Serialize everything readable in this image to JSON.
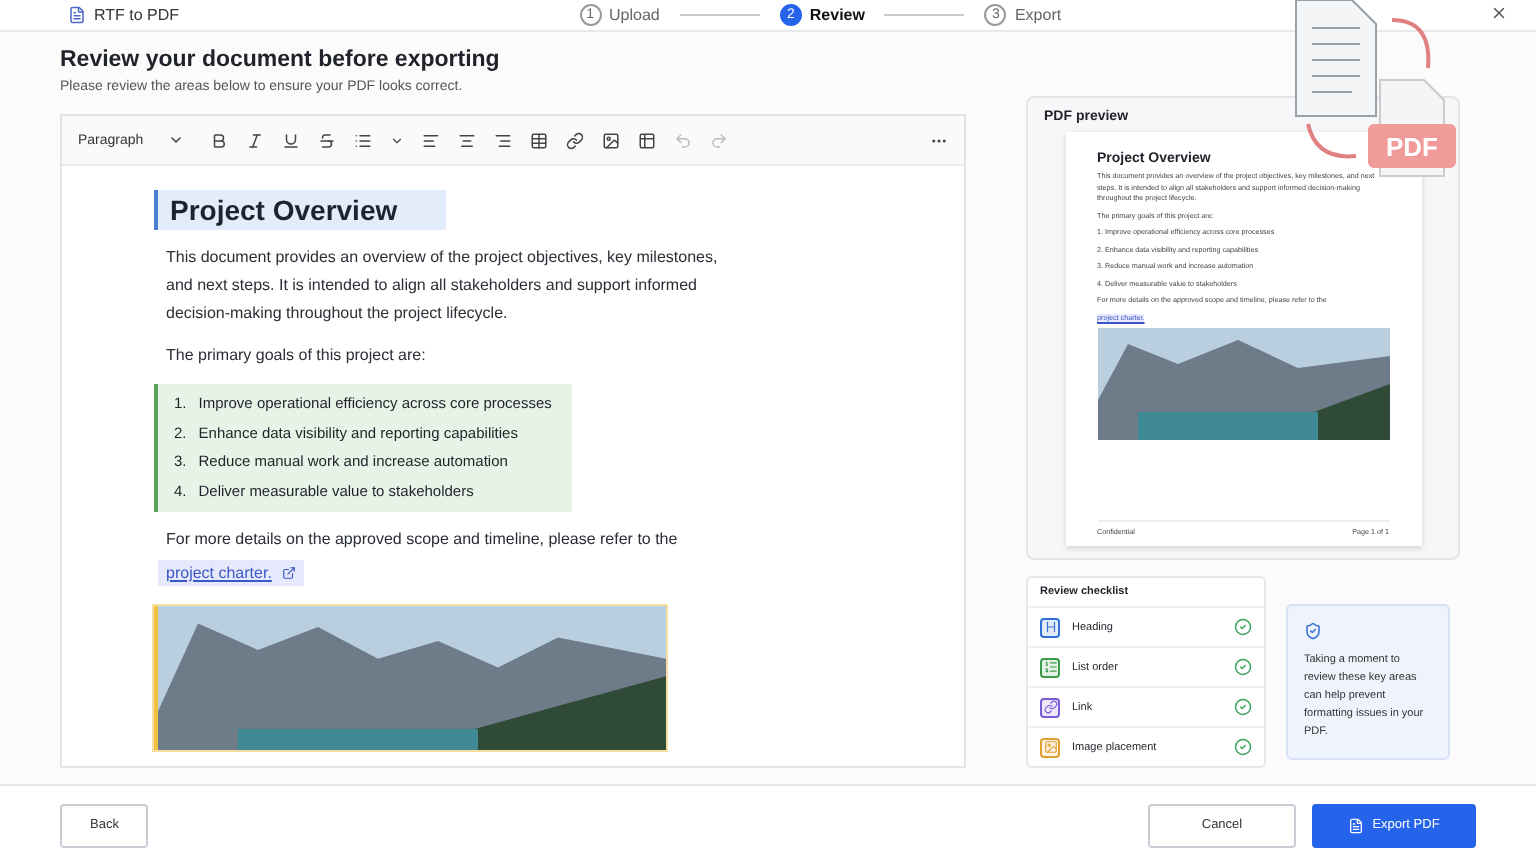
{
  "window": {
    "title": "RTF to PDF"
  },
  "steps": [
    {
      "number": "1",
      "label": "Upload",
      "selected": false
    },
    {
      "number": "2",
      "label": "Review",
      "selected": true
    },
    {
      "number": "3",
      "label": "Export",
      "selected": false
    }
  ],
  "page_title": "Review your document before exporting",
  "page_subtitle": "Please review the areas below to ensure your PDF looks correct.",
  "editor": {
    "block_style": "Paragraph",
    "heading": "Project Overview",
    "intro": "This document provides an overview of the project objectives, key milestones, and next steps. It is intended to align all stakeholders and support informed decision-making throughout the project lifecycle.",
    "goals_lead": "The primary goals of this project are:",
    "goals": [
      {
        "number": "1.",
        "text": "Improve operational efficiency across core processes"
      },
      {
        "number": "2.",
        "text": "Enhance data visibility and reporting capabilities"
      },
      {
        "number": "3.",
        "text": "Reduce manual work and increase automation"
      },
      {
        "number": "4.",
        "text": "Deliver measurable value to stakeholders"
      }
    ],
    "reference": "For more details on the approved scope and timeline, please refer to the",
    "link": "project charter."
  },
  "preview": {
    "title": "PDF preview",
    "heading": "Project Overview",
    "intro": "This document provides an overview of the project objectives, key milestones, and next steps. It is intended to align all stakeholders and support informed decision-making throughout the project lifecycle.",
    "goals_lead": "The primary goals of this project are:",
    "goals": [
      {
        "number": "1.",
        "text": "Improve operational efficiency across core processes"
      },
      {
        "number": "2.",
        "text": "Enhance data visibility and reporting capabilities"
      },
      {
        "number": "3.",
        "text": "Reduce manual work and increase automation"
      },
      {
        "number": "4.",
        "text": "Deliver measurable value to stakeholders"
      }
    ],
    "reference": "For more details on the approved scope and timeline, please refer to the",
    "link": "project charter.",
    "footer_left": "Confidential",
    "footer_right": "Page 1 of 1"
  },
  "illustration_label": "PDF",
  "checklist": {
    "title": "Review checklist",
    "items": [
      {
        "kind": "heading",
        "label": "Heading",
        "checked": true,
        "color": "#2f6fd6"
      },
      {
        "kind": "list",
        "label": "List order",
        "checked": true,
        "color": "#3c9a4c"
      },
      {
        "kind": "link",
        "label": "Link",
        "checked": true,
        "color": "#7a5bd6"
      },
      {
        "kind": "image",
        "label": "Image placement",
        "checked": true,
        "color": "#e0a030"
      }
    ]
  },
  "tip": "Taking a moment to review these key areas can help prevent formatting issues in your PDF.",
  "buttons": {
    "back": "Back",
    "cancel": "Cancel",
    "export": "Export PDF"
  }
}
